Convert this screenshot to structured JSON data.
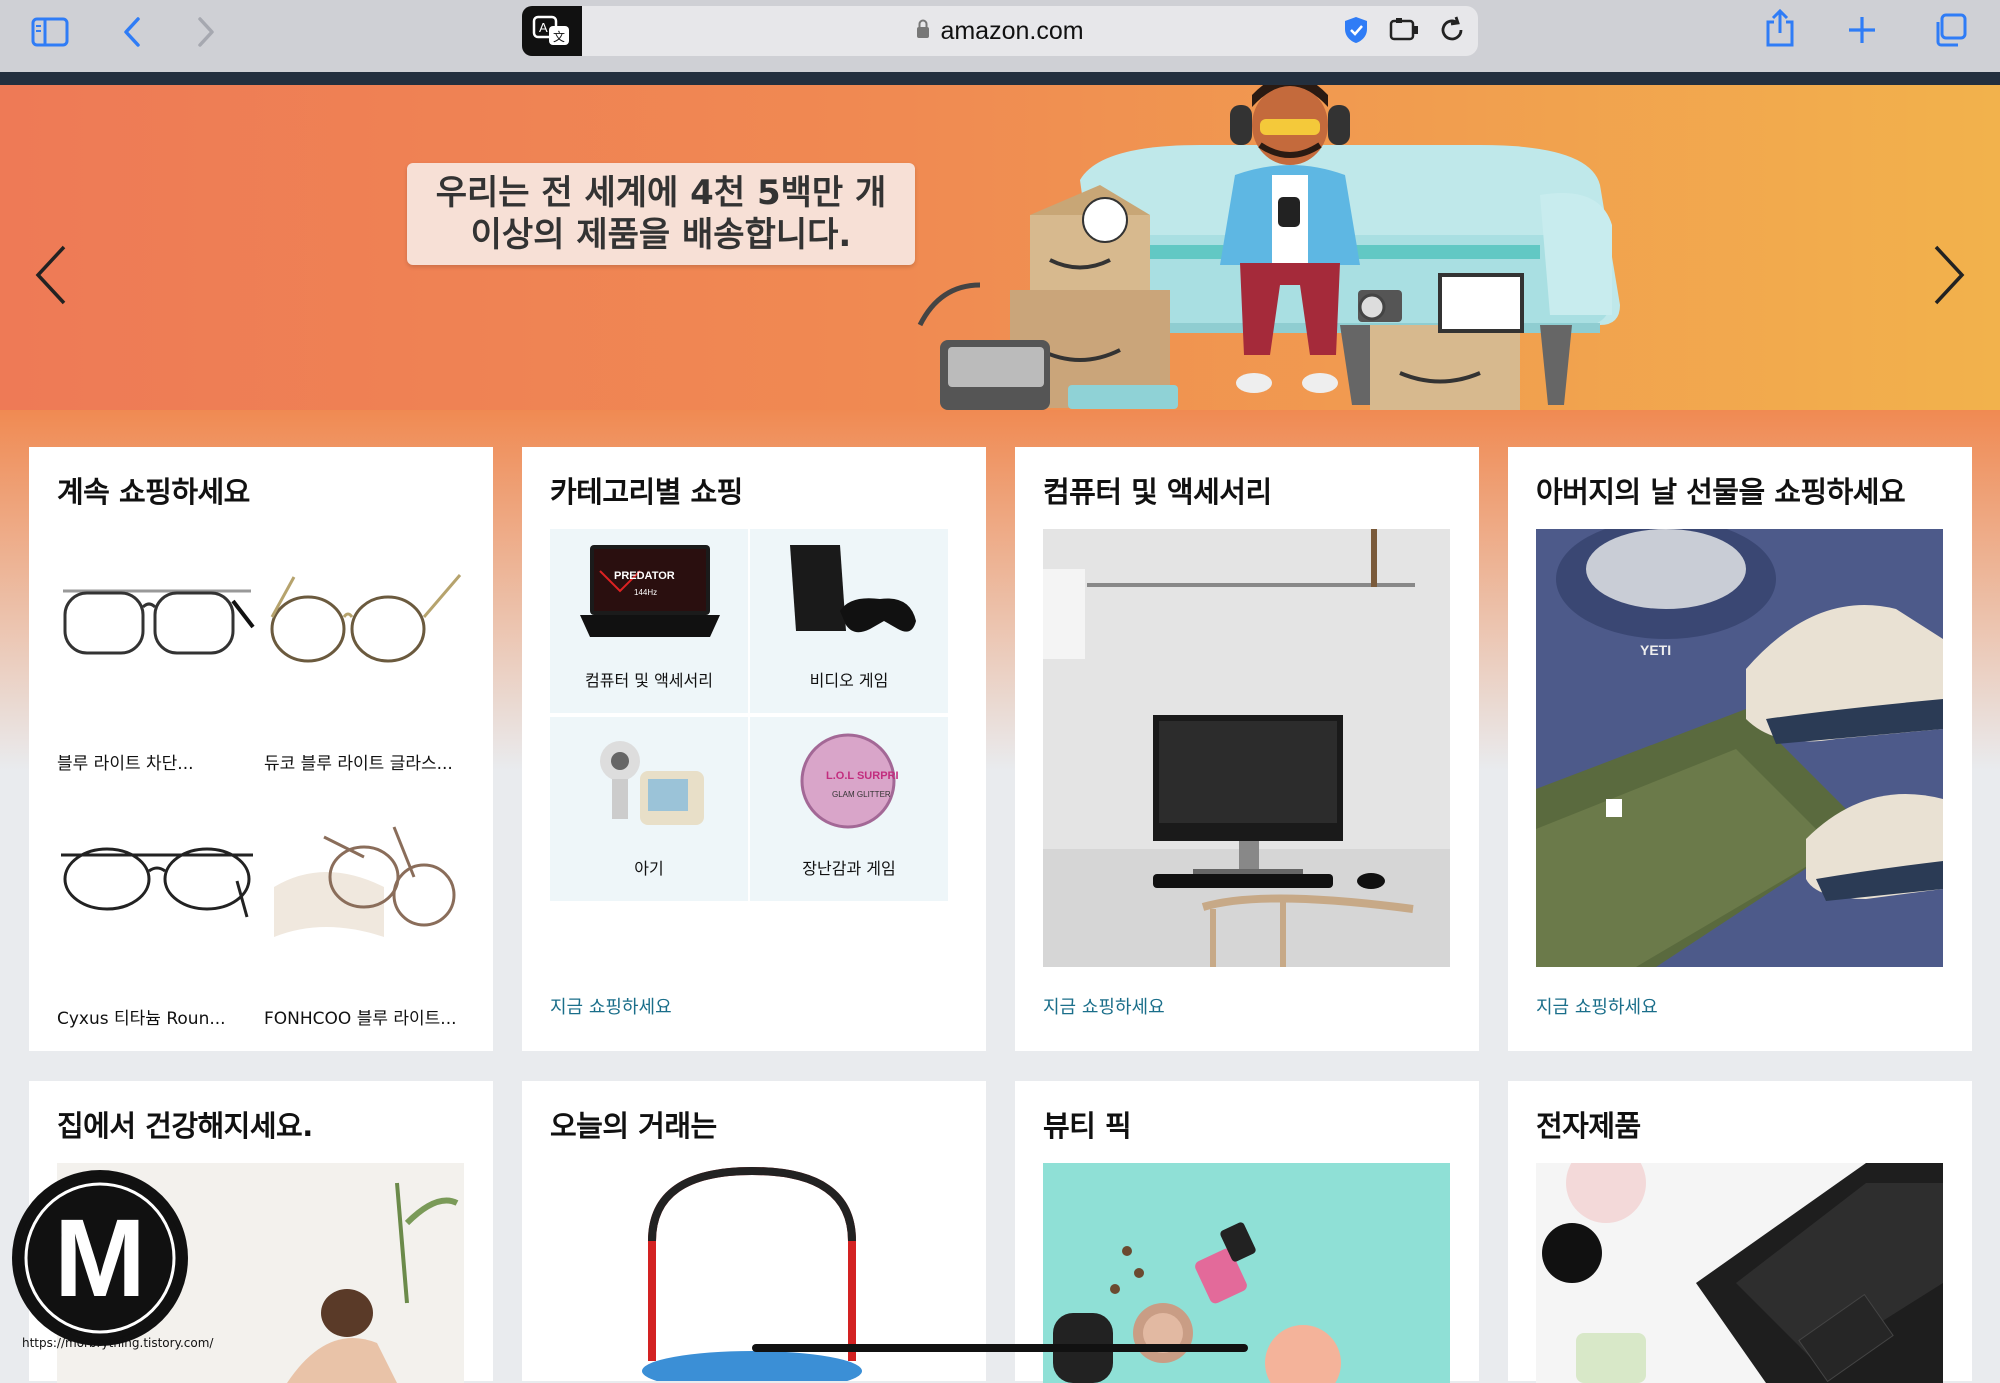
{
  "browser": {
    "url": "amazon.com",
    "toolbar_icons": [
      "sidebar-icon",
      "back-icon",
      "forward-icon",
      "translate-icon",
      "lock-icon",
      "privacy-shield-icon",
      "extension-icon",
      "reload-icon",
      "share-icon",
      "new-tab-icon",
      "tabs-icon"
    ]
  },
  "hero": {
    "caption": "우리는 전 세계에 4천 5백만 개 이상의 제품을 배송합니다."
  },
  "cards": {
    "continue": {
      "title": "계속 쇼핑하세요",
      "items": [
        "블루 라이트 차단...",
        "듀코 블루 라이트 글라스...",
        "Cyxus 티타늄 Roun...",
        "FONHCOO 블루 라이트..."
      ]
    },
    "categories": {
      "title": "카테고리별 쇼핑",
      "items": [
        "컴퓨터 및 액세서리",
        "비디오 게임",
        "아기",
        "장난감과 게임"
      ],
      "link": "지금 쇼핑하세요"
    },
    "computers": {
      "title": "컴퓨터 및 액세서리",
      "link": "지금 쇼핑하세요"
    },
    "fathers_day": {
      "title": "아버지의 날 선물을 쇼핑하세요",
      "link": "지금 쇼핑하세요"
    },
    "health": {
      "title": "집에서 건강해지세요."
    },
    "deals": {
      "title": "오늘의 거래는"
    },
    "beauty": {
      "title": "뷰티 픽"
    },
    "electronics": {
      "title": "전자제품"
    }
  },
  "product_text": {
    "laptop_brand": "PREDATOR",
    "laptop_sub": "144Hz",
    "toy_text": "L.O.L SURPRISE",
    "toy_sub": "GLAM GLITTER",
    "cooler_brand": "YETI"
  },
  "watermark": {
    "logo_text": "M",
    "url": "https://morbrything.tistory.com/"
  },
  "colors": {
    "nav": "#232f3e",
    "hero_left": "#ee7a56",
    "hero_right": "#f2b24c",
    "link": "#1a6e8a"
  }
}
